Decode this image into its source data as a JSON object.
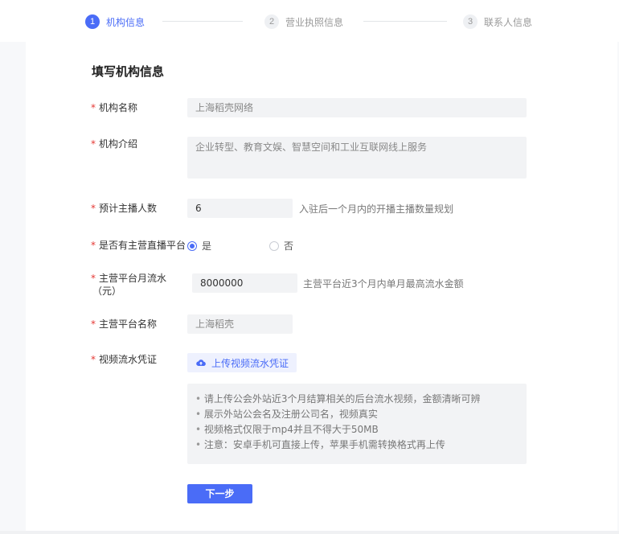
{
  "steps": [
    {
      "num": "1",
      "label": "机构信息"
    },
    {
      "num": "2",
      "label": "营业执照信息"
    },
    {
      "num": "3",
      "label": "联系人信息"
    }
  ],
  "form": {
    "title": "填写机构信息",
    "required_mark": "*",
    "org_name": {
      "label": "机构名称",
      "placeholder": "上海稻壳网络"
    },
    "org_intro": {
      "label": "机构介绍",
      "placeholder": "企业转型、教育文娱、智慧空间和工业互联网线上服务"
    },
    "anchor_count": {
      "label": "预计主播人数",
      "value": "6",
      "hint": "入驻后一个月内的开播主播数量规划"
    },
    "has_platform": {
      "label": "是否有主营直播平台",
      "options": [
        "是",
        "否"
      ],
      "selected": "是"
    },
    "monthly_flow": {
      "label_line1": "主营平台月流水",
      "label_line2": "（元）",
      "value": "8000000",
      "hint": "主营平台近3个月内单月最高流水金额"
    },
    "platform_name": {
      "label": "主营平台名称",
      "placeholder": "上海稻壳"
    },
    "video_proof": {
      "label": "视频流水凭证",
      "upload_label": "上传视频流水凭证",
      "tips": [
        "请上传公会外站近3个月结算相关的后台流水视频，金额清晰可辨",
        "展示外站公会名及注册公司名，视频真实",
        "视频格式仅限于mp4并且不得大于50MB",
        "注意：安卓手机可直接上传，苹果手机需转换格式再上传"
      ]
    },
    "next_label": "下一步"
  },
  "colors": {
    "accent": "#4a6cf7",
    "required": "#e53935"
  },
  "icons": {
    "upload": "cloud-upload-icon"
  }
}
